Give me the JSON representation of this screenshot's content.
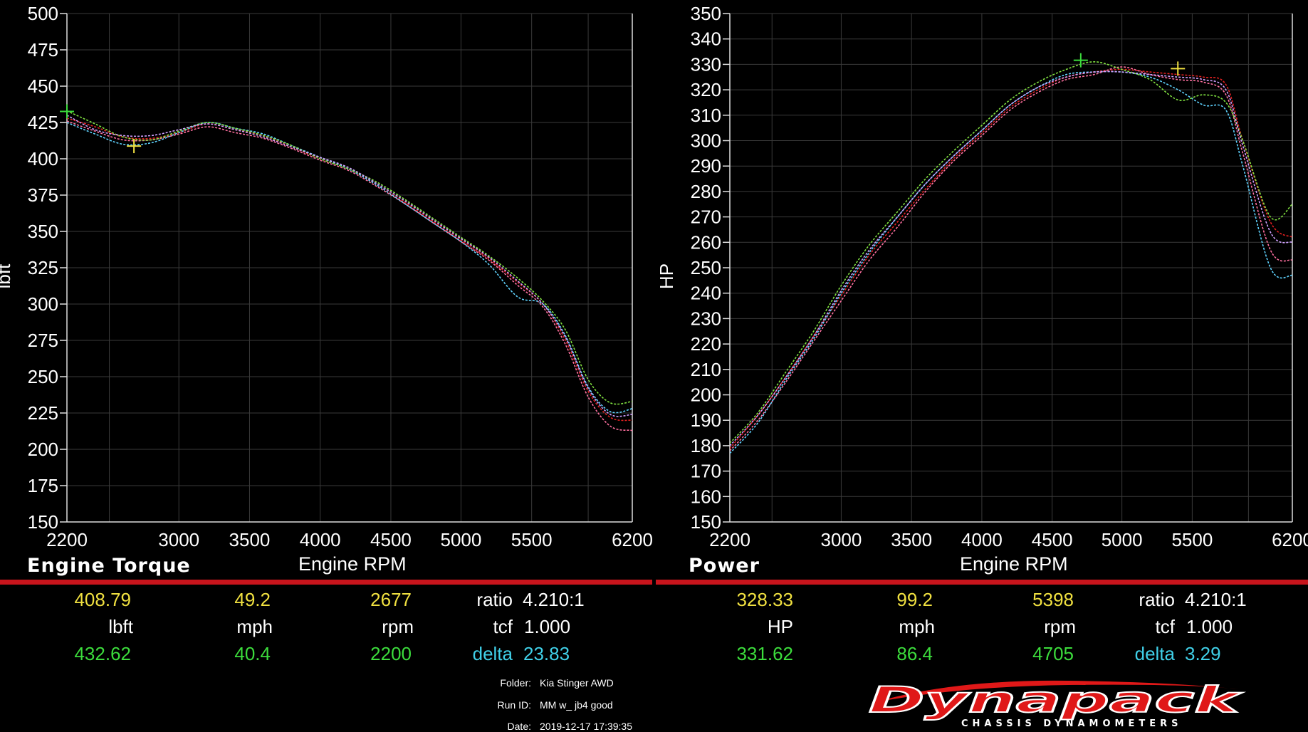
{
  "chart_data": [
    {
      "type": "line",
      "title": "Engine Torque",
      "xlabel": "Engine RPM",
      "ylabel": "lbft",
      "xlim": [
        2200,
        6200
      ],
      "ylim": [
        150,
        500
      ],
      "x_ticks": [
        "2200",
        "3000",
        "3500",
        "4000",
        "4500",
        "5000",
        "5500",
        "6200"
      ],
      "y_ticks": [
        "500",
        "475",
        "450",
        "425",
        "400",
        "375",
        "350",
        "325",
        "300",
        "275",
        "250",
        "225",
        "200",
        "175",
        "150"
      ],
      "x": [
        2200,
        2400,
        2600,
        2800,
        3000,
        3200,
        3400,
        3600,
        3800,
        4000,
        4200,
        4400,
        4600,
        4800,
        5000,
        5200,
        5400,
        5600,
        5800,
        6000,
        6100,
        6200
      ],
      "series": [
        {
          "color": "#e02020",
          "values": [
            428,
            422,
            415,
            414,
            418,
            424,
            420,
            416,
            408,
            400,
            393,
            382,
            370,
            357,
            344,
            331,
            315,
            300,
            275,
            240,
            222,
            220
          ]
        },
        {
          "color": "#ff70a0",
          "values": [
            426,
            419,
            413,
            413,
            417,
            422,
            418,
            414,
            407,
            399,
            392,
            381,
            369,
            356,
            343,
            330,
            313,
            298,
            272,
            236,
            216,
            213
          ]
        },
        {
          "color": "#5fd3ff",
          "values": [
            425,
            417,
            410,
            411,
            418,
            425,
            421,
            417,
            409,
            401,
            393,
            382,
            369,
            356,
            343,
            327,
            305,
            300,
            278,
            243,
            226,
            228
          ]
        },
        {
          "color": "#80e040",
          "values": [
            433,
            424,
            415,
            413,
            419,
            425,
            421,
            416,
            409,
            400,
            393,
            384,
            372,
            359,
            346,
            333,
            318,
            302,
            282,
            248,
            232,
            233
          ]
        },
        {
          "color": "#d0a0ff",
          "values": [
            430,
            420,
            416,
            416,
            420,
            424,
            420,
            415,
            408,
            401,
            394,
            383,
            371,
            358,
            345,
            332,
            316,
            300,
            277,
            242,
            224,
            224
          ]
        }
      ],
      "cursors": [
        {
          "x": 2677,
          "y": 408.79,
          "color": "#f0e040"
        },
        {
          "x": 2200,
          "y": 432.62,
          "color": "#3cdc3c"
        }
      ]
    },
    {
      "type": "line",
      "title": "Power",
      "xlabel": "Engine RPM",
      "ylabel": "HP",
      "xlim": [
        2200,
        6200
      ],
      "ylim": [
        150,
        350
      ],
      "x_ticks": [
        "2200",
        "3000",
        "3500",
        "4000",
        "4500",
        "5000",
        "5500",
        "6200"
      ],
      "y_ticks": [
        "350",
        "340",
        "330",
        "320",
        "310",
        "300",
        "290",
        "280",
        "270",
        "260",
        "250",
        "240",
        "230",
        "220",
        "210",
        "200",
        "190",
        "180",
        "170",
        "160",
        "150"
      ],
      "x": [
        2200,
        2400,
        2600,
        2800,
        3000,
        3200,
        3400,
        3600,
        3800,
        4000,
        4200,
        4400,
        4600,
        4800,
        5000,
        5200,
        5400,
        5600,
        5800,
        5950,
        6100,
        6200
      ],
      "series": [
        {
          "color": "#e02020",
          "values": [
            179,
            192,
            207,
            223,
            239,
            255,
            268,
            281,
            293,
            303,
            313,
            320,
            325,
            327,
            328,
            327,
            326,
            325,
            322,
            300,
            268,
            262
          ]
        },
        {
          "color": "#ff70a0",
          "values": [
            178,
            190,
            205,
            221,
            237,
            253,
            266,
            280,
            292,
            302,
            312,
            319,
            324,
            326,
            329,
            326,
            324,
            323,
            318,
            295,
            257,
            253
          ]
        },
        {
          "color": "#5fd3ff",
          "values": [
            177,
            189,
            206,
            222,
            240,
            256,
            270,
            283,
            294,
            304,
            314,
            321,
            326,
            327,
            327,
            325,
            320,
            314,
            312,
            290,
            250,
            247
          ]
        },
        {
          "color": "#80e040",
          "values": [
            181,
            193,
            209,
            225,
            243,
            259,
            272,
            285,
            296,
            306,
            316,
            323,
            328,
            331,
            328,
            324,
            316,
            318,
            315,
            300,
            270,
            275
          ]
        },
        {
          "color": "#d0a0ff",
          "values": [
            180,
            192,
            207,
            223,
            241,
            257,
            270,
            283,
            294,
            304,
            314,
            321,
            325,
            327,
            327,
            326,
            325,
            324,
            320,
            298,
            264,
            260
          ]
        }
      ],
      "cursors": [
        {
          "x": 5398,
          "y": 328.33,
          "color": "#f0e040"
        },
        {
          "x": 4705,
          "y": 331.62,
          "color": "#3cdc3c"
        }
      ]
    }
  ],
  "left_panel": {
    "title": "Engine Torque",
    "xlabel": "Engine RPM",
    "readout": {
      "cursor1": {
        "value": "408.79",
        "speed": "49.2",
        "rpm": "2677"
      },
      "units": {
        "value": "lbft",
        "speed": "mph",
        "rpm": "rpm"
      },
      "cursor2": {
        "value": "432.62",
        "speed": "40.4",
        "rpm": "2200"
      },
      "ratio_label": "ratio",
      "ratio_value": "4.210:1",
      "tcf_label": "tcf",
      "tcf_value": "1.000",
      "delta_label": "delta",
      "delta_value": "23.83"
    }
  },
  "right_panel": {
    "title": "Power",
    "xlabel": "Engine RPM",
    "readout": {
      "cursor1": {
        "value": "328.33",
        "speed": "99.2",
        "rpm": "5398"
      },
      "units": {
        "value": "HP",
        "speed": "mph",
        "rpm": "rpm"
      },
      "cursor2": {
        "value": "331.62",
        "speed": "86.4",
        "rpm": "4705"
      },
      "ratio_label": "ratio",
      "ratio_value": "4.210:1",
      "tcf_label": "tcf",
      "tcf_value": "1.000",
      "delta_label": "delta",
      "delta_value": "3.29"
    }
  },
  "run_info": {
    "folder_label": "Folder:",
    "folder_value": "Kia Stinger AWD",
    "run_label": "Run ID:",
    "run_value": "MM w_ jb4 good",
    "date_label": "Date:",
    "date_value": "2019-12-17 17:39:35"
  },
  "logo": {
    "main": "Dynapack",
    "sub": "CHASSIS DYNAMOMETERS",
    "color": "#e01818"
  }
}
